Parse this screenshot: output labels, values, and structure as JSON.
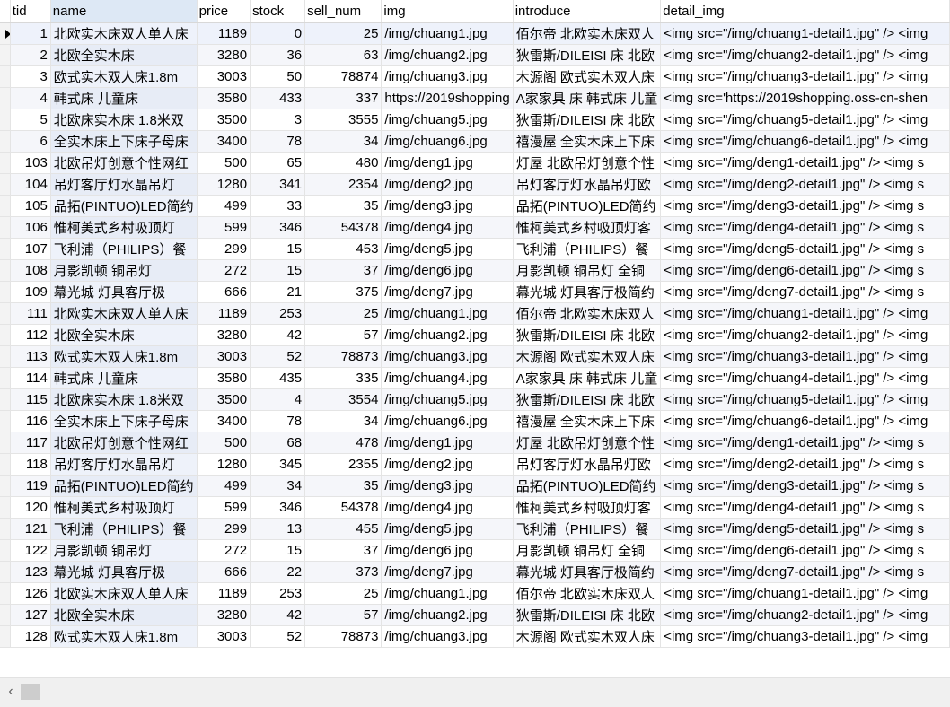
{
  "columns": [
    "tid",
    "name",
    "price",
    "stock",
    "sell_num",
    "img",
    "introduce",
    "detail_img"
  ],
  "rows": [
    [
      "1",
      "北欧实木床双人单人床",
      "1189",
      "0",
      "25",
      "/img/chuang1.jpg",
      "佰尔帝 北欧实木床双人",
      "<img src=\"/img/chuang1-detail1.jpg\" /> <img"
    ],
    [
      "2",
      "北欧全实木床",
      "3280",
      "36",
      "63",
      "/img/chuang2.jpg",
      "狄雷斯/DILEISI 床 北欧",
      "<img src=\"/img/chuang2-detail1.jpg\" /> <img"
    ],
    [
      "3",
      "欧式实木双人床1.8m",
      "3003",
      "50",
      "78874",
      "/img/chuang3.jpg",
      "木源阁 欧式实木双人床",
      "<img src=\"/img/chuang3-detail1.jpg\" /> <img"
    ],
    [
      "4",
      "韩式床 儿童床",
      "3580",
      "433",
      "337",
      "https://2019shopping",
      "A家家具 床 韩式床 儿童",
      "<img src='https://2019shopping.oss-cn-shen"
    ],
    [
      "5",
      "北欧床实木床 1.8米双",
      "3500",
      "3",
      "3555",
      "/img/chuang5.jpg",
      "狄雷斯/DILEISI 床 北欧",
      "<img src=\"/img/chuang5-detail1.jpg\" /> <img"
    ],
    [
      "6",
      "全实木床上下床子母床",
      "3400",
      "78",
      "34",
      "/img/chuang6.jpg",
      "禧漫屋 全实木床上下床",
      "<img src=\"/img/chuang6-detail1.jpg\" /> <img"
    ],
    [
      "103",
      "北欧吊灯创意个性网红",
      "500",
      "65",
      "480",
      "/img/deng1.jpg",
      "灯屋 北欧吊灯创意个性",
      "<img src=\"/img/deng1-detail1.jpg\" /> <img s"
    ],
    [
      "104",
      "吊灯客厅灯水晶吊灯",
      "1280",
      "341",
      "2354",
      "/img/deng2.jpg",
      "吊灯客厅灯水晶吊灯欧",
      "<img src=\"/img/deng2-detail1.jpg\" /> <img s"
    ],
    [
      "105",
      "品拓(PINTUO)LED简约",
      "499",
      "33",
      "35",
      "/img/deng3.jpg",
      "品拓(PINTUO)LED简约",
      "<img src=\"/img/deng3-detail1.jpg\" /> <img s"
    ],
    [
      "106",
      "惟柯美式乡村吸顶灯",
      "599",
      "346",
      "54378",
      "/img/deng4.jpg",
      "惟柯美式乡村吸顶灯客",
      "<img src=\"/img/deng4-detail1.jpg\" /> <img s"
    ],
    [
      "107",
      "飞利浦（PHILIPS）餐",
      "299",
      "15",
      "453",
      "/img/deng5.jpg",
      "飞利浦（PHILIPS）餐",
      "<img src=\"/img/deng5-detail1.jpg\" /> <img s"
    ],
    [
      "108",
      "月影凯顿 铜吊灯",
      "272",
      "15",
      "37",
      "/img/deng6.jpg",
      "月影凯顿 铜吊灯 全铜",
      "<img src=\"/img/deng6-detail1.jpg\" /> <img s"
    ],
    [
      "109",
      "幕光城 灯具客厅极",
      "666",
      "21",
      "375",
      "/img/deng7.jpg",
      "幕光城 灯具客厅极简约",
      "<img src=\"/img/deng7-detail1.jpg\" /> <img s"
    ],
    [
      "111",
      "北欧实木床双人单人床",
      "1189",
      "253",
      "25",
      "/img/chuang1.jpg",
      "佰尔帝 北欧实木床双人",
      "<img src=\"/img/chuang1-detail1.jpg\" /> <img"
    ],
    [
      "112",
      "北欧全实木床",
      "3280",
      "42",
      "57",
      "/img/chuang2.jpg",
      "狄雷斯/DILEISI 床 北欧",
      "<img src=\"/img/chuang2-detail1.jpg\" /> <img"
    ],
    [
      "113",
      "欧式实木双人床1.8m",
      "3003",
      "52",
      "78873",
      "/img/chuang3.jpg",
      "木源阁 欧式实木双人床",
      "<img src=\"/img/chuang3-detail1.jpg\" /> <img"
    ],
    [
      "114",
      "韩式床 儿童床",
      "3580",
      "435",
      "335",
      "/img/chuang4.jpg",
      "A家家具 床 韩式床 儿童",
      "<img src=\"/img/chuang4-detail1.jpg\" /> <img"
    ],
    [
      "115",
      "北欧床实木床 1.8米双",
      "3500",
      "4",
      "3554",
      "/img/chuang5.jpg",
      "狄雷斯/DILEISI 床 北欧",
      "<img src=\"/img/chuang5-detail1.jpg\" /> <img"
    ],
    [
      "116",
      "全实木床上下床子母床",
      "3400",
      "78",
      "34",
      "/img/chuang6.jpg",
      "禧漫屋 全实木床上下床",
      "<img src=\"/img/chuang6-detail1.jpg\" /> <img"
    ],
    [
      "117",
      "北欧吊灯创意个性网红",
      "500",
      "68",
      "478",
      "/img/deng1.jpg",
      "灯屋 北欧吊灯创意个性",
      "<img src=\"/img/deng1-detail1.jpg\" /> <img s"
    ],
    [
      "118",
      "吊灯客厅灯水晶吊灯",
      "1280",
      "345",
      "2355",
      "/img/deng2.jpg",
      "吊灯客厅灯水晶吊灯欧",
      "<img src=\"/img/deng2-detail1.jpg\" /> <img s"
    ],
    [
      "119",
      "品拓(PINTUO)LED简约",
      "499",
      "34",
      "35",
      "/img/deng3.jpg",
      "品拓(PINTUO)LED简约",
      "<img src=\"/img/deng3-detail1.jpg\" /> <img s"
    ],
    [
      "120",
      "惟柯美式乡村吸顶灯",
      "599",
      "346",
      "54378",
      "/img/deng4.jpg",
      "惟柯美式乡村吸顶灯客",
      "<img src=\"/img/deng4-detail1.jpg\" /> <img s"
    ],
    [
      "121",
      "飞利浦（PHILIPS）餐",
      "299",
      "13",
      "455",
      "/img/deng5.jpg",
      "飞利浦（PHILIPS）餐",
      "<img src=\"/img/deng5-detail1.jpg\" /> <img s"
    ],
    [
      "122",
      "月影凯顿 铜吊灯",
      "272",
      "15",
      "37",
      "/img/deng6.jpg",
      "月影凯顿 铜吊灯 全铜",
      "<img src=\"/img/deng6-detail1.jpg\" /> <img s"
    ],
    [
      "123",
      "幕光城 灯具客厅极",
      "666",
      "22",
      "373",
      "/img/deng7.jpg",
      "幕光城 灯具客厅极简约",
      "<img src=\"/img/deng7-detail1.jpg\" /> <img s"
    ],
    [
      "126",
      "北欧实木床双人单人床",
      "1189",
      "253",
      "25",
      "/img/chuang1.jpg",
      "佰尔帝 北欧实木床双人",
      "<img src=\"/img/chuang1-detail1.jpg\" /> <img"
    ],
    [
      "127",
      "北欧全实木床",
      "3280",
      "42",
      "57",
      "/img/chuang2.jpg",
      "狄雷斯/DILEISI 床 北欧",
      "<img src=\"/img/chuang2-detail1.jpg\" /> <img"
    ],
    [
      "128",
      "欧式实木双人床1.8m",
      "3003",
      "52",
      "78873",
      "/img/chuang3.jpg",
      "木源阁 欧式实木双人床",
      "<img src=\"/img/chuang3-detail1.jpg\" /> <img"
    ]
  ],
  "numeric_columns": [
    0,
    2,
    3,
    4
  ],
  "selected_column": "name",
  "current_row": 0,
  "scrollbar": {
    "left_arrow_icon": "chevron-left-icon"
  }
}
